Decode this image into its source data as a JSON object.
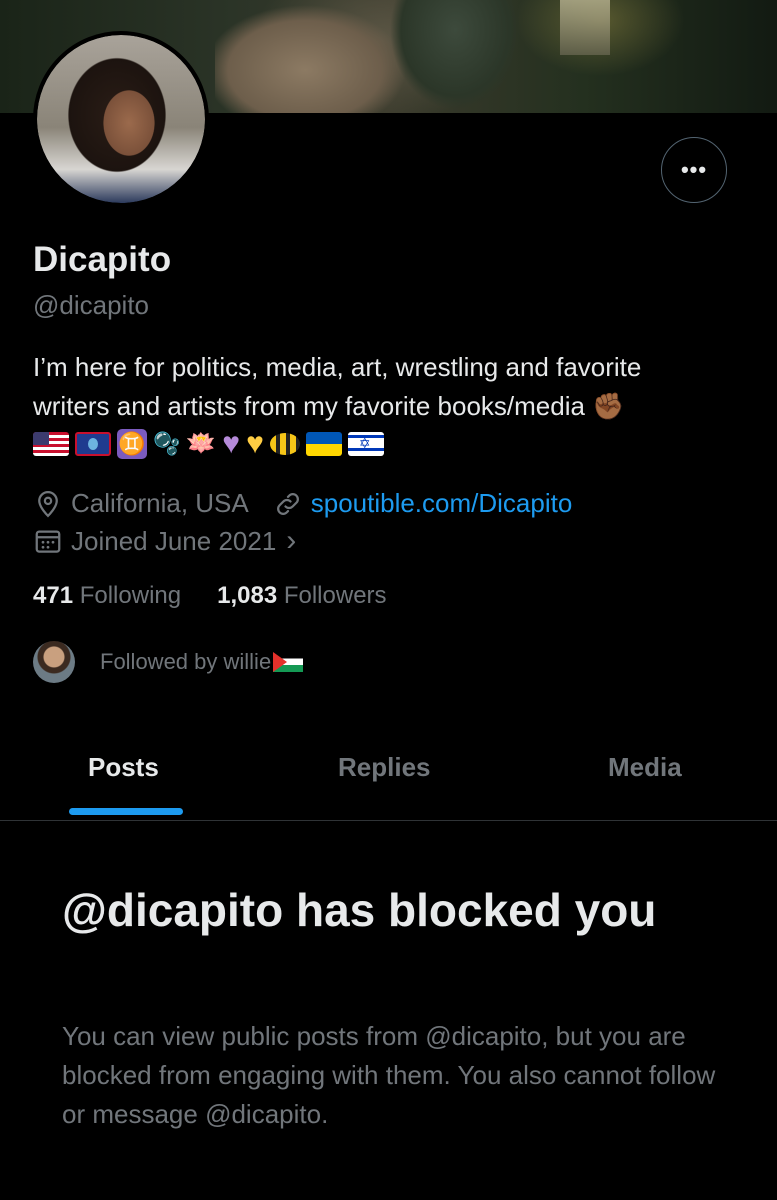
{
  "profile": {
    "name": "Dicapito",
    "handle": "@dicapito",
    "bio_line1": "I’m here for politics, media, art, wrestling and favorite",
    "bio_line2": "writers and artists from my favorite books/media",
    "bio_emoji_end": "✊🏾",
    "emoji_icons": [
      "flag-us-icon",
      "flag-guam-icon",
      "gemini-icon",
      "bubbles-icon",
      "lotus-icon",
      "purple-heart-icon",
      "yellow-heart-icon",
      "bee-icon",
      "flag-ukraine-icon",
      "flag-israel-icon"
    ],
    "gemini_glyph": "♊",
    "bubbles_glyph": "🫧",
    "lotus_glyph": "🪷",
    "purple_heart_glyph": "♥",
    "yellow_heart_glyph": "♥",
    "location": "California, USA",
    "website": "spoutible.com/Dicapito",
    "joined": "Joined June 2021",
    "joined_chevron": "›",
    "following_count": "471",
    "following_label": "Following",
    "followers_count": "1,083",
    "followers_label": "Followers",
    "followed_by": "Followed by willie",
    "more_button_glyph": "•••"
  },
  "tabs": [
    {
      "label": "Posts",
      "active": true
    },
    {
      "label": "Replies",
      "active": false
    },
    {
      "label": "Media",
      "active": false
    }
  ],
  "blocked": {
    "title": "@dicapito has blocked you",
    "message": "You can view public posts from @dicapito, but you are blocked from engaging with them. You also cannot follow or message @dicapito."
  },
  "colors": {
    "background": "#000000",
    "primary_text": "#e7e9ea",
    "secondary_text": "#71767b",
    "accent": "#1d9bf0",
    "border": "#2f3336"
  }
}
